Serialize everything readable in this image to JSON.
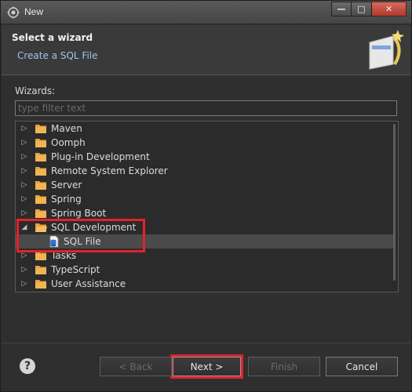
{
  "window": {
    "title": "New",
    "minimize": "—",
    "maximize": "□",
    "close": "✕"
  },
  "header": {
    "title": "Select a wizard",
    "subtitle": "Create a SQL File"
  },
  "wizards_label": "Wizards:",
  "filter": {
    "placeholder": "type filter text",
    "value": ""
  },
  "tree": {
    "items": [
      {
        "label": "Maven",
        "expanded": false,
        "type": "folder"
      },
      {
        "label": "Oomph",
        "expanded": false,
        "type": "folder"
      },
      {
        "label": "Plug-in Development",
        "expanded": false,
        "type": "folder"
      },
      {
        "label": "Remote System Explorer",
        "expanded": false,
        "type": "folder"
      },
      {
        "label": "Server",
        "expanded": false,
        "type": "folder"
      },
      {
        "label": "Spring",
        "expanded": false,
        "type": "folder"
      },
      {
        "label": "Spring Boot",
        "expanded": false,
        "type": "folder"
      },
      {
        "label": "SQL Development",
        "expanded": true,
        "type": "folder"
      },
      {
        "label": "SQL File",
        "type": "file",
        "selected": true
      },
      {
        "label": "Tasks",
        "expanded": false,
        "type": "folder"
      },
      {
        "label": "TypeScript",
        "expanded": false,
        "type": "folder"
      },
      {
        "label": "User Assistance",
        "expanded": false,
        "type": "folder"
      }
    ]
  },
  "buttons": {
    "help": "?",
    "back": "< Back",
    "next": "Next >",
    "finish": "Finish",
    "cancel": "Cancel"
  },
  "colors": {
    "highlight": "#e2222c",
    "folder": "#e8a23c",
    "subtitle": "#9fc3ea"
  },
  "icons": {
    "collapsed": "chevron-right-icon",
    "expanded": "chevron-down-icon",
    "folder": "folder-icon",
    "file": "sql-file-icon"
  }
}
